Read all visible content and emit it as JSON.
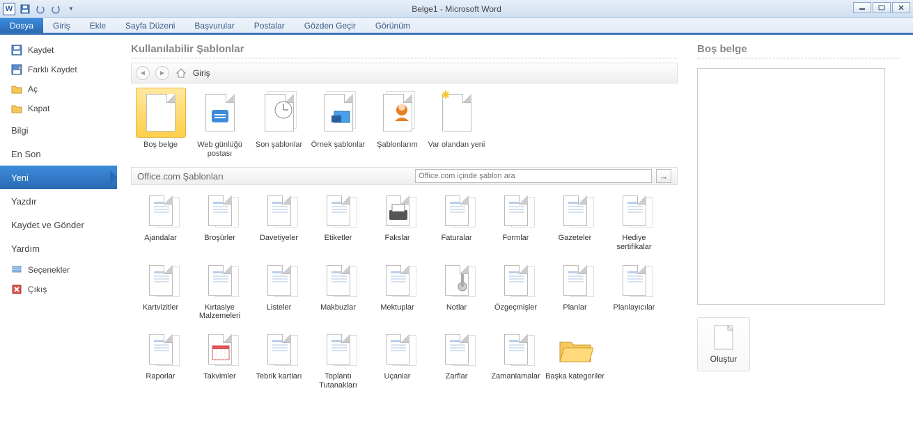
{
  "app": {
    "title": "Belge1 - Microsoft Word",
    "icon_letter": "W"
  },
  "ribbon": {
    "file_tab": "Dosya",
    "tabs": [
      "Giriş",
      "Ekle",
      "Sayfa Düzeni",
      "Başvurular",
      "Postalar",
      "Gözden Geçir",
      "Görünüm"
    ]
  },
  "sidenav": {
    "top": [
      {
        "label": "Kaydet",
        "icon": "save"
      },
      {
        "label": "Farklı Kaydet",
        "icon": "saveas"
      },
      {
        "label": "Aç",
        "icon": "open"
      },
      {
        "label": "Kapat",
        "icon": "close"
      }
    ],
    "mid": [
      {
        "label": "Bilgi"
      },
      {
        "label": "En Son"
      },
      {
        "label": "Yeni",
        "selected": true
      },
      {
        "label": "Yazdır"
      },
      {
        "label": "Kaydet ve Gönder"
      },
      {
        "label": "Yardım"
      }
    ],
    "bottom": [
      {
        "label": "Seçenekler",
        "icon": "options"
      },
      {
        "label": "Çıkış",
        "icon": "exit"
      }
    ]
  },
  "templates": {
    "heading": "Kullanılabilir Şablonlar",
    "breadcrumb": "Giriş",
    "top_row": [
      "Boş belge",
      "Web günlüğü postası",
      "Son şablonlar",
      "Örnek şablonlar",
      "Şablonlarım",
      "Var olandan yeni"
    ],
    "office_section": {
      "title": "Office.com Şablonları",
      "search_placeholder": "Office.com içinde şablon ara"
    },
    "office_items": [
      "Ajandalar",
      "Broşürler",
      "Davetiyeler",
      "Etiketler",
      "Fakslar",
      "Faturalar",
      "Formlar",
      "Gazeteler",
      "Hediye sertifikalar",
      "Kartvizitler",
      "Kırtasiye Malzemeleri",
      "Listeler",
      "Makbuzlar",
      "Mektuplar",
      "Notlar",
      "Özgeçmişler",
      "Planlar",
      "Planlayıcılar",
      "Raporlar",
      "Takvimler",
      "Tebrik kartları",
      "Toplantı Tutanakları",
      "Uçanlar",
      "Zarflar",
      "Zamanlamalar",
      "Başka kategoriler"
    ]
  },
  "preview": {
    "title": "Boş belge",
    "create_label": "Oluştur"
  }
}
